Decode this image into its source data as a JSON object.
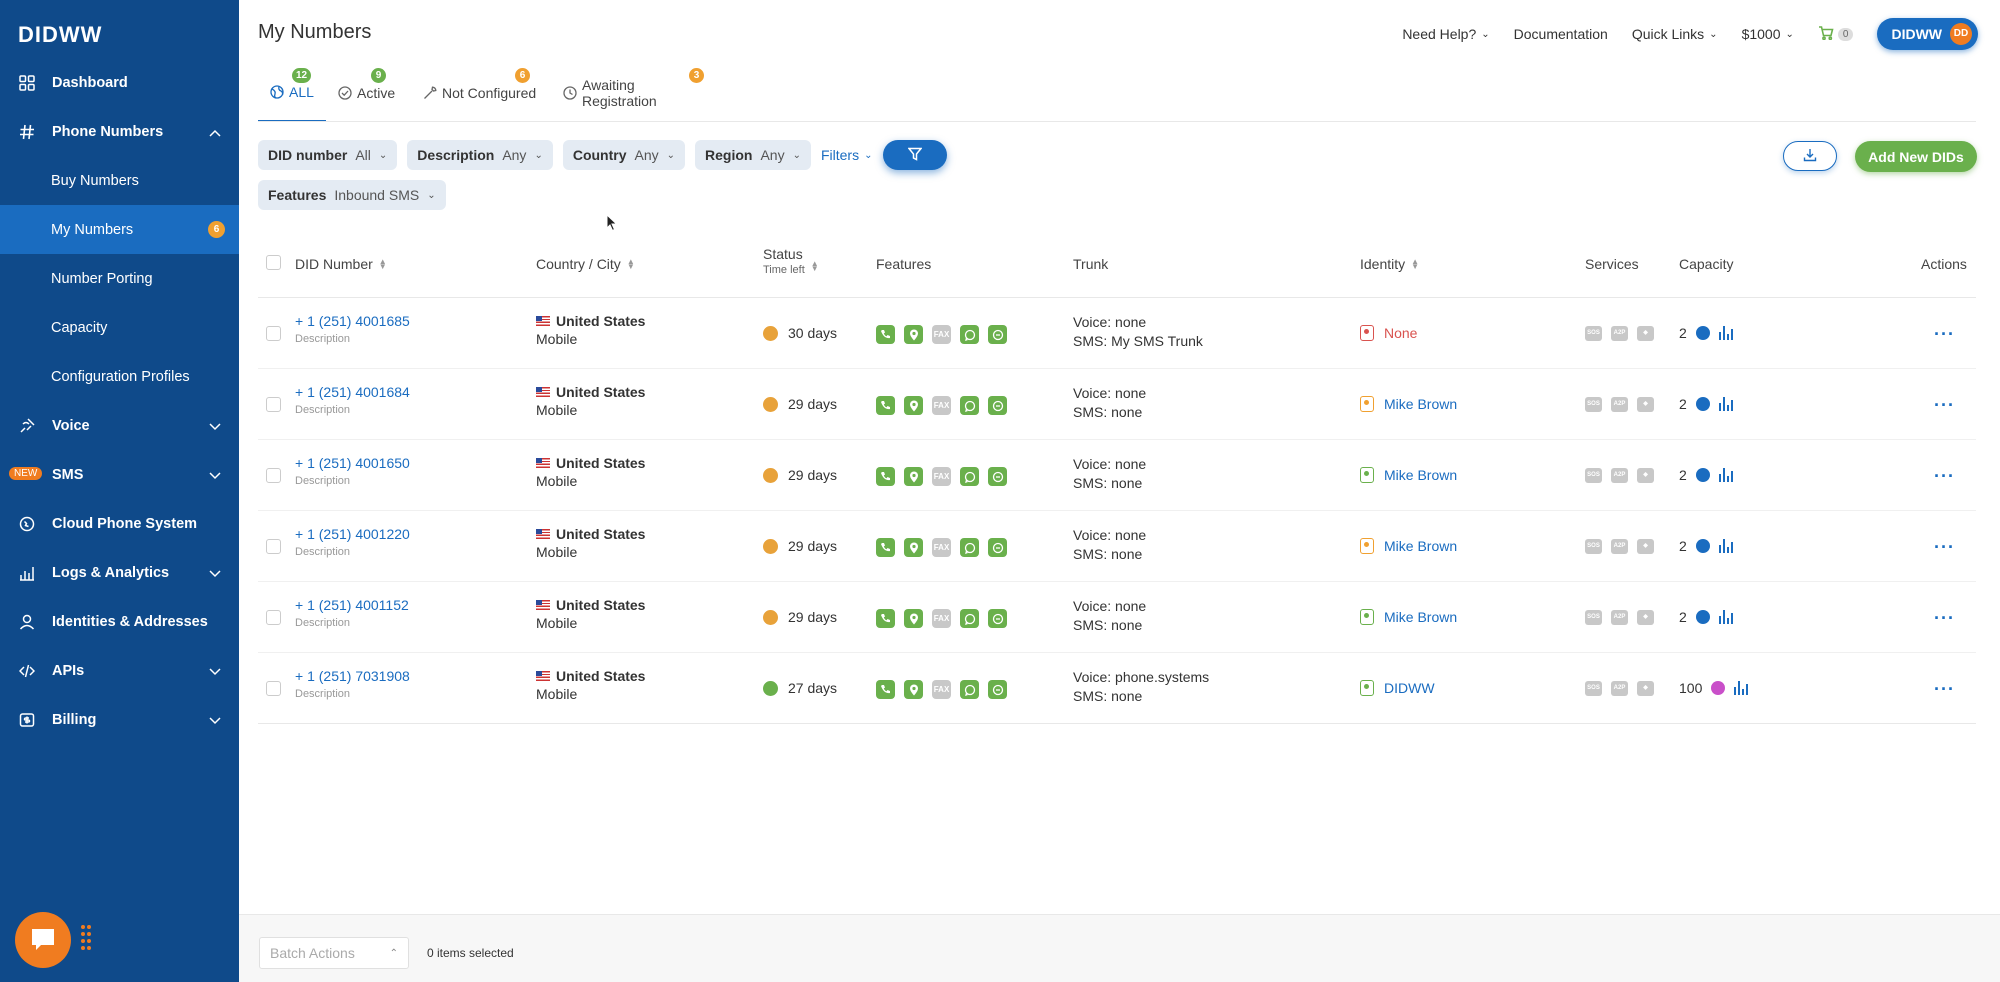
{
  "sidebar": {
    "logo": "DIDWW",
    "items": [
      {
        "label": "Dashboard",
        "icon": "grid-icon"
      },
      {
        "label": "Phone Numbers",
        "icon": "hash-icon",
        "expanded": true,
        "children": [
          {
            "label": "Buy Numbers"
          },
          {
            "label": "My Numbers",
            "badge": "6",
            "active": true
          },
          {
            "label": "Number Porting"
          },
          {
            "label": "Capacity"
          },
          {
            "label": "Configuration Profiles"
          }
        ]
      },
      {
        "label": "Voice",
        "icon": "voice-icon"
      },
      {
        "label": "SMS",
        "icon": "sms-icon",
        "new_badge": "NEW"
      },
      {
        "label": "Cloud Phone System",
        "icon": "cloud-phone-icon"
      },
      {
        "label": "Logs & Analytics",
        "icon": "analytics-icon"
      },
      {
        "label": "Identities & Addresses",
        "icon": "person-icon"
      },
      {
        "label": "APIs",
        "icon": "code-icon"
      },
      {
        "label": "Billing",
        "icon": "billing-icon"
      }
    ]
  },
  "header": {
    "title": "My Numbers",
    "need_help": "Need Help?",
    "documentation": "Documentation",
    "quick_links": "Quick Links",
    "balance": "$1000",
    "cart_count": "0",
    "user": "DIDWW",
    "user_initials": "DD"
  },
  "tabs": [
    {
      "label": "ALL",
      "count": "12",
      "badge_color": "#6ab04c",
      "active": true
    },
    {
      "label": "Active",
      "count": "9",
      "badge_color": "#6ab04c"
    },
    {
      "label": "Not Configured",
      "count": "6",
      "badge_color": "#f0a030"
    },
    {
      "label": "Awaiting Registration",
      "count": "3",
      "badge_color": "#f0a030"
    }
  ],
  "filters": {
    "did_number": {
      "label": "DID number",
      "value": "All"
    },
    "description": {
      "label": "Description",
      "value": "Any"
    },
    "country": {
      "label": "Country",
      "value": "Any"
    },
    "region": {
      "label": "Region",
      "value": "Any"
    },
    "filters_link": "Filters",
    "features": {
      "label": "Features",
      "value": "Inbound SMS"
    }
  },
  "add_button": "Add New DIDs",
  "table": {
    "columns": {
      "did": "DID Number",
      "country": "Country / City",
      "status": "Status",
      "status_sub": "Time left",
      "features": "Features",
      "trunk": "Trunk",
      "identity": "Identity",
      "services": "Services",
      "capacity": "Capacity",
      "actions": "Actions"
    },
    "rows": [
      {
        "did": "+ 1 (251) 4001685",
        "desc": "Description",
        "country": "United States",
        "city": "Mobile",
        "status": "30 days",
        "status_color": "#e8a23a",
        "voice": "Voice: none",
        "sms": "SMS: My SMS Trunk",
        "identity": "None",
        "identity_color": "#d9534f",
        "capacity": "2",
        "cap_color": "#1a6cc0"
      },
      {
        "did": "+ 1 (251) 4001684",
        "desc": "Description",
        "country": "United States",
        "city": "Mobile",
        "status": "29 days",
        "status_color": "#e8a23a",
        "voice": "Voice: none",
        "sms": "SMS: none",
        "identity": "Mike Brown",
        "identity_color": "#1a6cc0",
        "identity_icon_color": "#f0a030",
        "capacity": "2",
        "cap_color": "#1a6cc0"
      },
      {
        "did": "+ 1 (251) 4001650",
        "desc": "Description",
        "country": "United States",
        "city": "Mobile",
        "status": "29 days",
        "status_color": "#e8a23a",
        "voice": "Voice: none",
        "sms": "SMS: none",
        "identity": "Mike Brown",
        "identity_color": "#1a6cc0",
        "identity_icon_color": "#6ab04c",
        "capacity": "2",
        "cap_color": "#1a6cc0"
      },
      {
        "did": "+ 1 (251) 4001220",
        "desc": "Description",
        "country": "United States",
        "city": "Mobile",
        "status": "29 days",
        "status_color": "#e8a23a",
        "voice": "Voice: none",
        "sms": "SMS: none",
        "identity": "Mike Brown",
        "identity_color": "#1a6cc0",
        "identity_icon_color": "#f0a030",
        "capacity": "2",
        "cap_color": "#1a6cc0"
      },
      {
        "did": "+ 1 (251) 4001152",
        "desc": "Description",
        "country": "United States",
        "city": "Mobile",
        "status": "29 days",
        "status_color": "#e8a23a",
        "voice": "Voice: none",
        "sms": "SMS: none",
        "identity": "Mike Brown",
        "identity_color": "#1a6cc0",
        "identity_icon_color": "#6ab04c",
        "capacity": "2",
        "cap_color": "#1a6cc0"
      },
      {
        "did": "+ 1 (251) 7031908",
        "desc": "Description",
        "country": "United States",
        "city": "Mobile",
        "status": "27 days",
        "status_color": "#6ab04c",
        "voice": "Voice: phone.systems",
        "sms": "SMS: none",
        "identity": "DIDWW",
        "identity_color": "#1a6cc0",
        "identity_icon_color": "#6ab04c",
        "capacity": "100",
        "cap_color": "#c94fc9"
      }
    ]
  },
  "footer": {
    "batch_actions": "Batch Actions",
    "selected": "0 items selected"
  }
}
